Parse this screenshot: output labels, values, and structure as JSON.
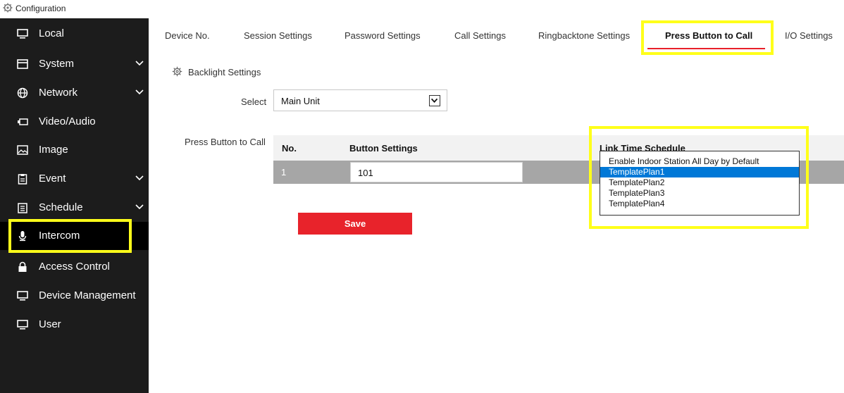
{
  "app": {
    "title": "Configuration"
  },
  "sidebar": {
    "items": [
      {
        "label": "Local",
        "icon": "monitor-icon"
      },
      {
        "label": "System",
        "icon": "window-icon",
        "chevron": true
      },
      {
        "label": "Network",
        "icon": "globe-icon",
        "chevron": true
      },
      {
        "label": "Video/Audio",
        "icon": "camera-icon"
      },
      {
        "label": "Image",
        "icon": "image-icon"
      },
      {
        "label": "Event",
        "icon": "clipboard-icon",
        "chevron": true
      },
      {
        "label": "Schedule",
        "icon": "calendar-icon",
        "chevron": true
      },
      {
        "label": "Intercom",
        "icon": "microphone-icon",
        "active": true
      },
      {
        "label": "Access Control",
        "icon": "lock-icon"
      },
      {
        "label": "Device Management",
        "icon": "monitor-icon"
      },
      {
        "label": "User",
        "icon": "monitor-icon"
      }
    ]
  },
  "tabs": [
    {
      "label": "Device No."
    },
    {
      "label": "Session Settings"
    },
    {
      "label": "Password Settings"
    },
    {
      "label": "Call Settings"
    },
    {
      "label": "Ringbacktone Settings"
    },
    {
      "label": "Press Button to Call",
      "active": true
    },
    {
      "label": "I/O Settings"
    }
  ],
  "section": {
    "title": "Backlight Settings"
  },
  "select": {
    "label": "Select",
    "value": "Main Unit"
  },
  "press_button": {
    "label": "Press Button to Call",
    "columns": {
      "no": "No.",
      "button_settings": "Button Settings",
      "link_time_schedule": "Link Time Schedule"
    },
    "rows": [
      {
        "no": "1",
        "button_value": "101"
      }
    ]
  },
  "schedule_dropdown": {
    "options": [
      "Enable Indoor Station All Day by Default",
      "TemplatePlan1",
      "TemplatePlan2",
      "TemplatePlan3",
      "TemplatePlan4"
    ],
    "selected_index": 1
  },
  "actions": {
    "save_label": "Save"
  },
  "colors": {
    "sidebar_bg": "#1c1c1c",
    "accent": "#e8202a",
    "highlight": "#ffff1a",
    "selection": "#0078d7"
  }
}
